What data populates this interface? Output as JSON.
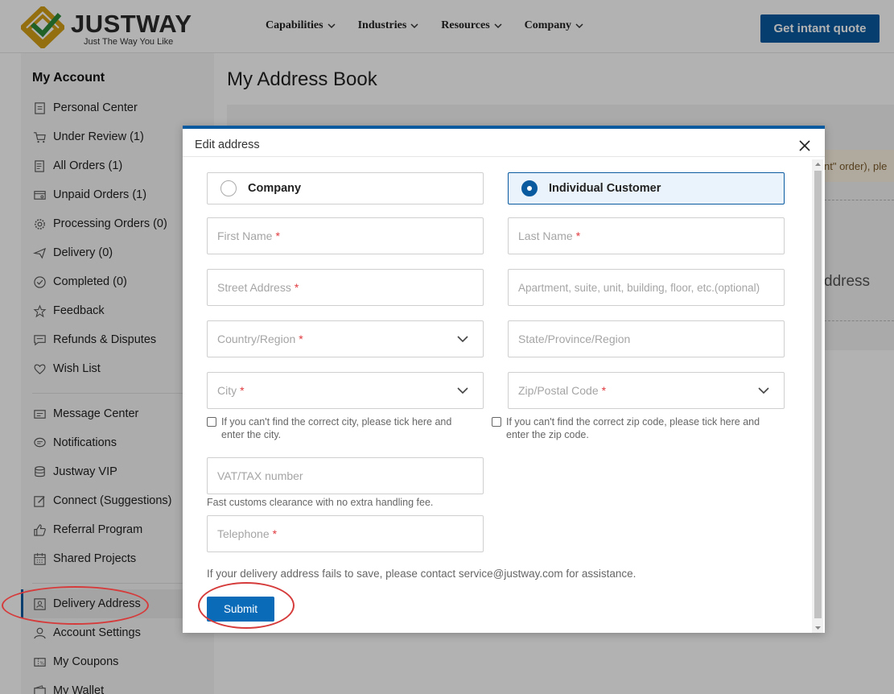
{
  "brand": {
    "name": "JUSTWAY",
    "tagline": "Just The Way You Like"
  },
  "nav": {
    "items": [
      "Capabilities",
      "Industries",
      "Resources",
      "Company"
    ],
    "cta": "Get intant quote"
  },
  "sidebar": {
    "title": "My Account",
    "items": [
      {
        "label": "Personal Center",
        "icon": "personal-center-icon"
      },
      {
        "label": "Under Review (1)",
        "icon": "cart-icon"
      },
      {
        "label": "All Orders (1)",
        "icon": "orders-icon"
      },
      {
        "label": "Unpaid Orders (1)",
        "icon": "unpaid-icon"
      },
      {
        "label": "Processing Orders (0)",
        "icon": "gear-icon"
      },
      {
        "label": "Delivery (0)",
        "icon": "plane-icon"
      },
      {
        "label": "Completed (0)",
        "icon": "check-circle-icon"
      },
      {
        "label": "Feedback",
        "icon": "star-icon"
      },
      {
        "label": "Refunds & Disputes",
        "icon": "dispute-icon"
      },
      {
        "label": "Wish List",
        "icon": "heart-icon"
      },
      {
        "label": "Message Center",
        "icon": "message-icon"
      },
      {
        "label": "Notifications",
        "icon": "notification-icon"
      },
      {
        "label": "Justway VIP",
        "icon": "vip-icon"
      },
      {
        "label": "Connect (Suggestions)",
        "icon": "edit-icon"
      },
      {
        "label": "Referral Program",
        "icon": "thumbs-up-icon"
      },
      {
        "label": "Shared Projects",
        "icon": "calendar-icon"
      },
      {
        "label": "Delivery Address",
        "icon": "address-icon"
      },
      {
        "label": "Account Settings",
        "icon": "user-icon"
      },
      {
        "label": "My Coupons",
        "icon": "coupon-icon"
      },
      {
        "label": "My Wallet",
        "icon": "wallet-icon"
      }
    ],
    "active": "Delivery Address"
  },
  "main": {
    "title": "My Address Book",
    "notice_fragment": "nt\" order), ple",
    "address_fragment": "ddress"
  },
  "modal": {
    "title": "Edit address",
    "type_company": "Company",
    "type_individual": "Individual Customer",
    "selected_type": "Individual Customer",
    "fields": {
      "first_name": "First Name",
      "last_name": "Last Name",
      "street": "Street Address",
      "apartment": "Apartment, suite, unit, building, floor, etc.(optional)",
      "country": "Country/Region",
      "state": "State/Province/Region",
      "city": "City",
      "zip": "Zip/Postal Code",
      "vat": "VAT/TAX number",
      "telephone": "Telephone"
    },
    "required_mark": "*",
    "city_check": "If you can't find the correct city, please tick here and enter the city.",
    "zip_check": "If you can't find the correct zip code, please tick here and enter the zip code.",
    "vat_hint": "Fast customs clearance with no extra handling fee.",
    "note": "If your delivery address fails to save, please contact service@justway.com for assistance.",
    "submit": "Submit"
  },
  "colors": {
    "brand_blue": "#0a5aa0",
    "required": "#e0393e",
    "annotation": "#d63b3b",
    "logo_gold": "#d4a017"
  }
}
